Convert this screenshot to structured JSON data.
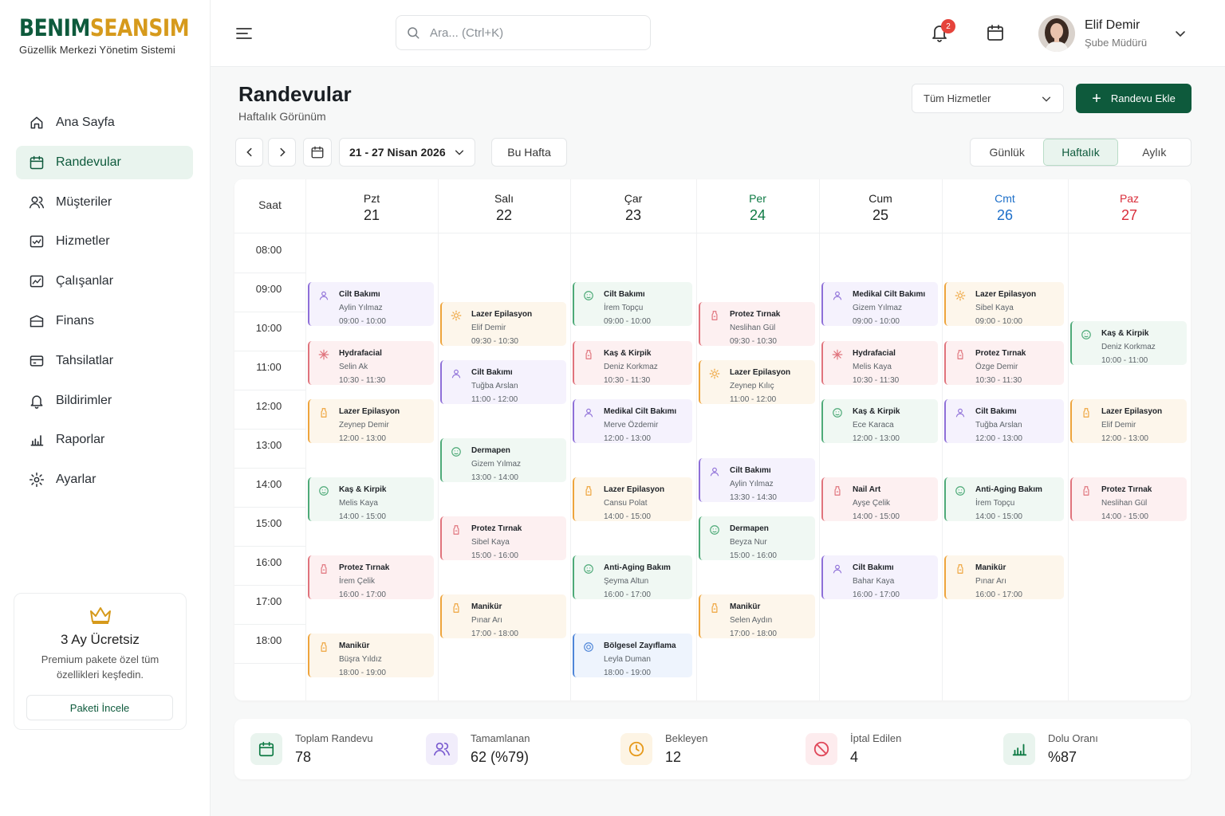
{
  "brand": {
    "name_a": "BENIM",
    "name_b": "SEANSIM",
    "subtitle": "Güzellik Merkezi Yönetim Sistemi"
  },
  "nav": [
    {
      "label": "Ana Sayfa",
      "icon": "home-icon",
      "active": false
    },
    {
      "label": "Randevular",
      "icon": "calendar-icon",
      "active": true
    },
    {
      "label": "Müşteriler",
      "icon": "users-icon",
      "active": false
    },
    {
      "label": "Hizmetler",
      "icon": "services-icon",
      "active": false
    },
    {
      "label": "Çalışanlar",
      "icon": "staff-icon",
      "active": false
    },
    {
      "label": "Finans",
      "icon": "wallet-icon",
      "active": false
    },
    {
      "label": "Tahsilatlar",
      "icon": "card-icon",
      "active": false
    },
    {
      "label": "Bildirimler",
      "icon": "bell-icon",
      "active": false
    },
    {
      "label": "Raporlar",
      "icon": "chart-icon",
      "active": false
    },
    {
      "label": "Ayarlar",
      "icon": "gear-icon",
      "active": false
    }
  ],
  "promo": {
    "title": "3 Ay Ücretsiz",
    "text": "Premium pakete özel tüm özellikleri keşfedin.",
    "button": "Paketi İncele"
  },
  "topbar": {
    "search_placeholder": "Ara... (Ctrl+K)",
    "notification_count": "2",
    "user_name": "Elif Demir",
    "user_role": "Şube Müdürü"
  },
  "page": {
    "title": "Randevular",
    "subtitle": "Haftalık Görünüm"
  },
  "toolbar": {
    "service_filter": "Tüm Hizmetler",
    "add_button": "Randevu Ekle",
    "date_range": "21 - 27 Nisan 2026",
    "this_week": "Bu Hafta"
  },
  "views": [
    {
      "label": "Günlük",
      "active": false
    },
    {
      "label": "Haftalık",
      "active": true
    },
    {
      "label": "Aylık",
      "active": false
    }
  ],
  "calendar": {
    "time_header": "Saat",
    "times": [
      "08:00",
      "09:00",
      "10:00",
      "11:00",
      "12:00",
      "13:00",
      "14:00",
      "15:00",
      "16:00",
      "17:00",
      "18:00"
    ],
    "days": [
      {
        "name": "Pzt",
        "num": "21",
        "color": "#222222"
      },
      {
        "name": "Salı",
        "num": "22",
        "color": "#222222"
      },
      {
        "name": "Çar",
        "num": "23",
        "color": "#222222"
      },
      {
        "name": "Per",
        "num": "24",
        "color": "#0e7a44"
      },
      {
        "name": "Cum",
        "num": "25",
        "color": "#222222"
      },
      {
        "name": "Cmt",
        "num": "26",
        "color": "#1d6fc9"
      },
      {
        "name": "Paz",
        "num": "27",
        "color": "#d92d3a"
      }
    ],
    "events": [
      {
        "day": 0,
        "title": "Cilt Bakımı",
        "name": "Aylin Yılmaz",
        "time": "09:00 - 10:00",
        "type": "purple",
        "icon": "user-icon"
      },
      {
        "day": 0,
        "title": "Hydrafacial",
        "name": "Selin Ak",
        "time": "10:30 - 11:30",
        "type": "red",
        "icon": "sparkle-icon"
      },
      {
        "day": 0,
        "title": "Lazer Epilasyon",
        "name": "Zeynep Demir",
        "time": "12:00 - 13:00",
        "type": "orange",
        "icon": "bottle-icon"
      },
      {
        "day": 0,
        "title": "Kaş & Kirpik",
        "name": "Melis Kaya",
        "time": "14:00 - 15:00",
        "type": "green",
        "icon": "face-icon"
      },
      {
        "day": 0,
        "title": "Protez Tırnak",
        "name": "İrem Çelik",
        "time": "16:00 - 17:00",
        "type": "red",
        "icon": "bottle-icon"
      },
      {
        "day": 0,
        "title": "Manikür",
        "name": "Büşra Yıldız",
        "time": "18:00 - 19:00",
        "type": "orange",
        "icon": "bottle-icon"
      },
      {
        "day": 1,
        "title": "Lazer Epilasyon",
        "name": "Elif Demir",
        "time": "09:30 - 10:30",
        "type": "orange",
        "icon": "sun-icon"
      },
      {
        "day": 1,
        "title": "Cilt Bakımı",
        "name": "Tuğba Arslan",
        "time": "11:00 - 12:00",
        "type": "purple",
        "icon": "user-icon"
      },
      {
        "day": 1,
        "title": "Dermapen",
        "name": "Gizem Yılmaz",
        "time": "13:00 - 14:00",
        "type": "green",
        "icon": "face-icon"
      },
      {
        "day": 1,
        "title": "Protez Tırnak",
        "name": "Sibel Kaya",
        "time": "15:00 - 16:00",
        "type": "red",
        "icon": "bottle-icon"
      },
      {
        "day": 1,
        "title": "Manikür",
        "name": "Pınar Arı",
        "time": "17:00 - 18:00",
        "type": "orange",
        "icon": "bottle-icon"
      },
      {
        "day": 2,
        "title": "Cilt Bakımı",
        "name": "İrem Topçu",
        "time": "09:00 - 10:00",
        "type": "green",
        "icon": "face-icon"
      },
      {
        "day": 2,
        "title": "Kaş & Kirpik",
        "name": "Deniz Korkmaz",
        "time": "10:30 - 11:30",
        "type": "red",
        "icon": "bottle-icon"
      },
      {
        "day": 2,
        "title": "Medikal Cilt Bakımı",
        "name": "Merve Özdemir",
        "time": "12:00 - 13:00",
        "type": "purple",
        "icon": "user-icon"
      },
      {
        "day": 2,
        "title": "Lazer Epilasyon",
        "name": "Cansu Polat",
        "time": "14:00 - 15:00",
        "type": "orange",
        "icon": "bottle-icon"
      },
      {
        "day": 2,
        "title": "Anti-Aging Bakım",
        "name": "Şeyma Altun",
        "time": "16:00 - 17:00",
        "type": "green",
        "icon": "face-icon"
      },
      {
        "day": 2,
        "title": "Bölgesel Zayıflama",
        "name": "Leyla Duman",
        "time": "18:00 - 19:00",
        "type": "blue",
        "icon": "target-icon"
      },
      {
        "day": 3,
        "title": "Protez Tırnak",
        "name": "Neslihan Gül",
        "time": "09:30 - 10:30",
        "type": "red",
        "icon": "bottle-icon"
      },
      {
        "day": 3,
        "title": "Lazer Epilasyon",
        "name": "Zeynep Kılıç",
        "time": "11:00 - 12:00",
        "type": "orange",
        "icon": "sun-icon"
      },
      {
        "day": 3,
        "title": "Cilt Bakımı",
        "name": "Aylin Yılmaz",
        "time": "13:30 - 14:30",
        "type": "purple",
        "icon": "user-icon"
      },
      {
        "day": 3,
        "title": "Dermapen",
        "name": "Beyza Nur",
        "time": "15:00 - 16:00",
        "type": "green",
        "icon": "face-icon"
      },
      {
        "day": 3,
        "title": "Manikür",
        "name": "Selen Aydın",
        "time": "17:00 - 18:00",
        "type": "orange",
        "icon": "bottle-icon"
      },
      {
        "day": 4,
        "title": "Medikal Cilt Bakımı",
        "name": "Gizem Yılmaz",
        "time": "09:00 - 10:00",
        "type": "purple",
        "icon": "user-icon"
      },
      {
        "day": 4,
        "title": "Hydrafacial",
        "name": "Melis Kaya",
        "time": "10:30 - 11:30",
        "type": "red",
        "icon": "sparkle-icon"
      },
      {
        "day": 4,
        "title": "Kaş & Kirpik",
        "name": "Ece Karaca",
        "time": "12:00 - 13:00",
        "type": "green",
        "icon": "face-icon"
      },
      {
        "day": 4,
        "title": "Nail Art",
        "name": "Ayşe Çelik",
        "time": "14:00 - 15:00",
        "type": "red",
        "icon": "bottle-icon"
      },
      {
        "day": 4,
        "title": "Cilt Bakımı",
        "name": "Bahar Kaya",
        "time": "16:00 - 17:00",
        "type": "purple",
        "icon": "user-icon"
      },
      {
        "day": 5,
        "title": "Lazer Epilasyon",
        "name": "Sibel Kaya",
        "time": "09:00 - 10:00",
        "type": "orange",
        "icon": "sun-icon"
      },
      {
        "day": 5,
        "title": "Protez Tırnak",
        "name": "Özge Demir",
        "time": "10:30 - 11:30",
        "type": "red",
        "icon": "bottle-icon"
      },
      {
        "day": 5,
        "title": "Cilt Bakımı",
        "name": "Tuğba Arslan",
        "time": "12:00 - 13:00",
        "type": "purple",
        "icon": "user-icon"
      },
      {
        "day": 5,
        "title": "Anti-Aging Bakım",
        "name": "İrem Topçu",
        "time": "14:00 - 15:00",
        "type": "green",
        "icon": "face-icon"
      },
      {
        "day": 5,
        "title": "Manikür",
        "name": "Pınar Arı",
        "time": "16:00 - 17:00",
        "type": "orange",
        "icon": "bottle-icon"
      },
      {
        "day": 6,
        "title": "Kaş & Kirpik",
        "name": "Deniz Korkmaz",
        "time": "10:00 - 11:00",
        "type": "green",
        "icon": "face-icon"
      },
      {
        "day": 6,
        "title": "Lazer Epilasyon",
        "name": "Elif Demir",
        "time": "12:00 - 13:00",
        "type": "orange",
        "icon": "bottle-icon"
      },
      {
        "day": 6,
        "title": "Protez Tırnak",
        "name": "Neslihan Gül",
        "time": "14:00 - 15:00",
        "type": "red",
        "icon": "bottle-icon"
      }
    ]
  },
  "event_colors": {
    "purple": {
      "bg": "#f5f2fd",
      "border": "#8e6fd8"
    },
    "red": {
      "bg": "#fdf0f1",
      "border": "#e0737c"
    },
    "orange": {
      "bg": "#fdf6eb",
      "border": "#eea43c"
    },
    "green": {
      "bg": "#f0f8f3",
      "border": "#4eaa78"
    },
    "blue": {
      "bg": "#eef4fd",
      "border": "#4f86d8"
    }
  },
  "stats": [
    {
      "label": "Toplam Randevu",
      "value": "78",
      "icon": "calendar-icon",
      "color": "#0e7a44",
      "bg": "#e9f4ee"
    },
    {
      "label": "Tamamlanan",
      "value": "62  (%79)",
      "icon": "users-icon",
      "color": "#7a5bd0",
      "bg": "#f1edfb"
    },
    {
      "label": "Bekleyen",
      "value": "12",
      "icon": "clock-icon",
      "color": "#e69a1c",
      "bg": "#fdf4e4"
    },
    {
      "label": "İptal Edilen",
      "value": "4",
      "icon": "cancel-icon",
      "color": "#e0485a",
      "bg": "#fdecee"
    },
    {
      "label": "Dolu Oranı",
      "value": "%87",
      "icon": "chart-icon",
      "color": "#0e7a44",
      "bg": "#e9f4ee"
    }
  ]
}
